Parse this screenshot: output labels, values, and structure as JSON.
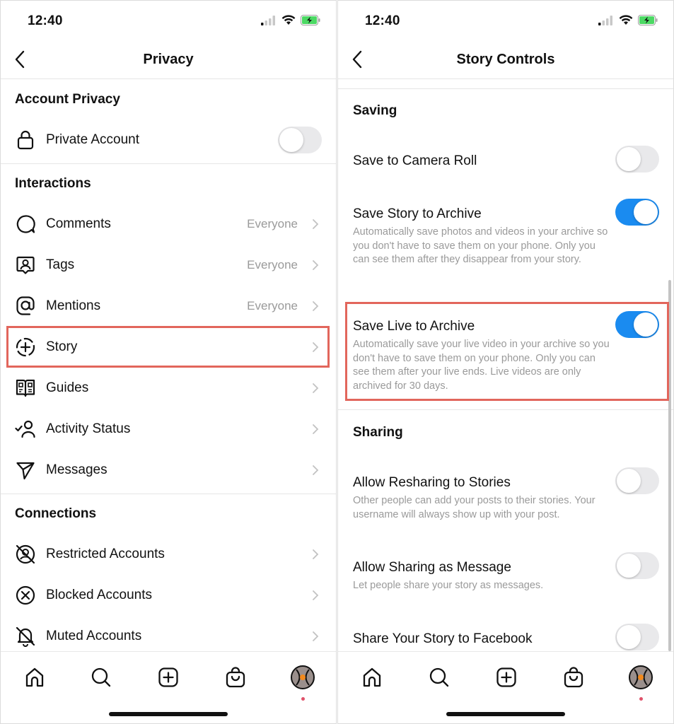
{
  "left": {
    "status": {
      "time": "12:40"
    },
    "nav": {
      "title": "Privacy"
    },
    "sections": {
      "account_privacy": {
        "title": "Account Privacy",
        "private_account": {
          "label": "Private Account",
          "enabled": false
        }
      },
      "interactions": {
        "title": "Interactions",
        "items": [
          {
            "label": "Comments",
            "value": "Everyone",
            "icon": "comment-icon"
          },
          {
            "label": "Tags",
            "value": "Everyone",
            "icon": "tag-person-icon"
          },
          {
            "label": "Mentions",
            "value": "Everyone",
            "icon": "at-sign-icon"
          },
          {
            "label": "Story",
            "value": "",
            "icon": "story-add-icon",
            "highlighted": true
          },
          {
            "label": "Guides",
            "value": "",
            "icon": "guide-book-icon"
          },
          {
            "label": "Activity Status",
            "value": "",
            "icon": "activity-status-icon"
          },
          {
            "label": "Messages",
            "value": "",
            "icon": "paper-plane-icon"
          }
        ]
      },
      "connections": {
        "title": "Connections",
        "items": [
          {
            "label": "Restricted Accounts",
            "icon": "restricted-icon"
          },
          {
            "label": "Blocked Accounts",
            "icon": "blocked-icon"
          },
          {
            "label": "Muted Accounts",
            "icon": "muted-bell-icon"
          }
        ]
      }
    }
  },
  "right": {
    "status": {
      "time": "12:40"
    },
    "nav": {
      "title": "Story Controls"
    },
    "saving": {
      "title": "Saving",
      "items": [
        {
          "title": "Save to Camera Roll",
          "description": "",
          "enabled": false
        },
        {
          "title": "Save Story to Archive",
          "description": "Automatically save photos and videos in your archive so you don't have to save them on your phone. Only you can see them after they disappear from your story.",
          "enabled": true
        },
        {
          "title": "Save Live to Archive",
          "description": "Automatically save your live video in your archive so you don't have to save them on your phone. Only you can see them after your live ends. Live videos are only archived for 30 days.",
          "enabled": true,
          "highlighted": true
        }
      ]
    },
    "sharing": {
      "title": "Sharing",
      "items": [
        {
          "title": "Allow Resharing to Stories",
          "description": "Other people can add your posts to their stories. Your username will always show up with your post.",
          "enabled": false
        },
        {
          "title": "Allow Sharing as Message",
          "description": "Let people share your story as messages.",
          "enabled": false
        },
        {
          "title": "Share Your Story to Facebook",
          "description": "",
          "enabled": false
        }
      ]
    }
  },
  "tab_bar": {
    "tabs": [
      "home-icon",
      "search-icon",
      "create-post-icon",
      "shop-bag-icon",
      "profile-avatar"
    ],
    "profile_notification": true
  },
  "colors": {
    "toggle_on": "#1a8bf0",
    "toggle_off": "#e9e9eb",
    "highlight": "#e2665c",
    "secondary_text": "#9a9a9a",
    "notification_dot": "#e0526a"
  }
}
